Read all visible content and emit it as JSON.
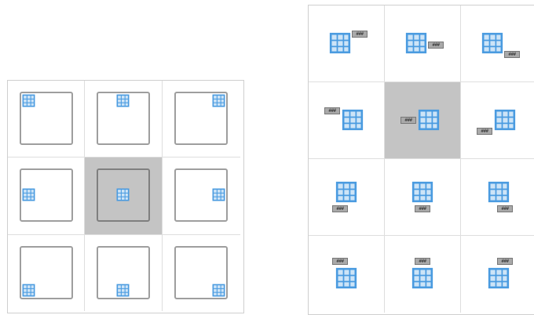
{
  "colors": {
    "table_blue": "#4a9be0",
    "table_fill": "#cde4f7",
    "selected_bg": "#c4c4c4",
    "cell_border": "#dedede",
    "caption_fill": "#a9a9a9"
  },
  "icons": {
    "table": "table-icon",
    "caption": "caption-placeholder"
  },
  "anchor_picker": {
    "selected_index": 4,
    "cells": [
      {
        "position": "top-left"
      },
      {
        "position": "top-center"
      },
      {
        "position": "top-right"
      },
      {
        "position": "middle-left"
      },
      {
        "position": "middle-center"
      },
      {
        "position": "middle-right"
      },
      {
        "position": "bottom-left"
      },
      {
        "position": "bottom-center"
      },
      {
        "position": "bottom-right"
      }
    ]
  },
  "caption_picker": {
    "selected_index": 4,
    "cells": [
      {
        "variant": "rt",
        "caption": "###"
      },
      {
        "variant": "rm",
        "caption": "###"
      },
      {
        "variant": "rb",
        "caption": "###"
      },
      {
        "variant": "lt",
        "caption": "###"
      },
      {
        "variant": "lm",
        "caption": "###"
      },
      {
        "variant": "lb",
        "caption": "###"
      },
      {
        "variant": "bl",
        "caption": "###"
      },
      {
        "variant": "bc",
        "caption": "###"
      },
      {
        "variant": "br",
        "caption": "###"
      },
      {
        "variant": "al",
        "caption": "###"
      },
      {
        "variant": "ac",
        "caption": "###"
      },
      {
        "variant": "ar",
        "caption": "###"
      }
    ]
  }
}
